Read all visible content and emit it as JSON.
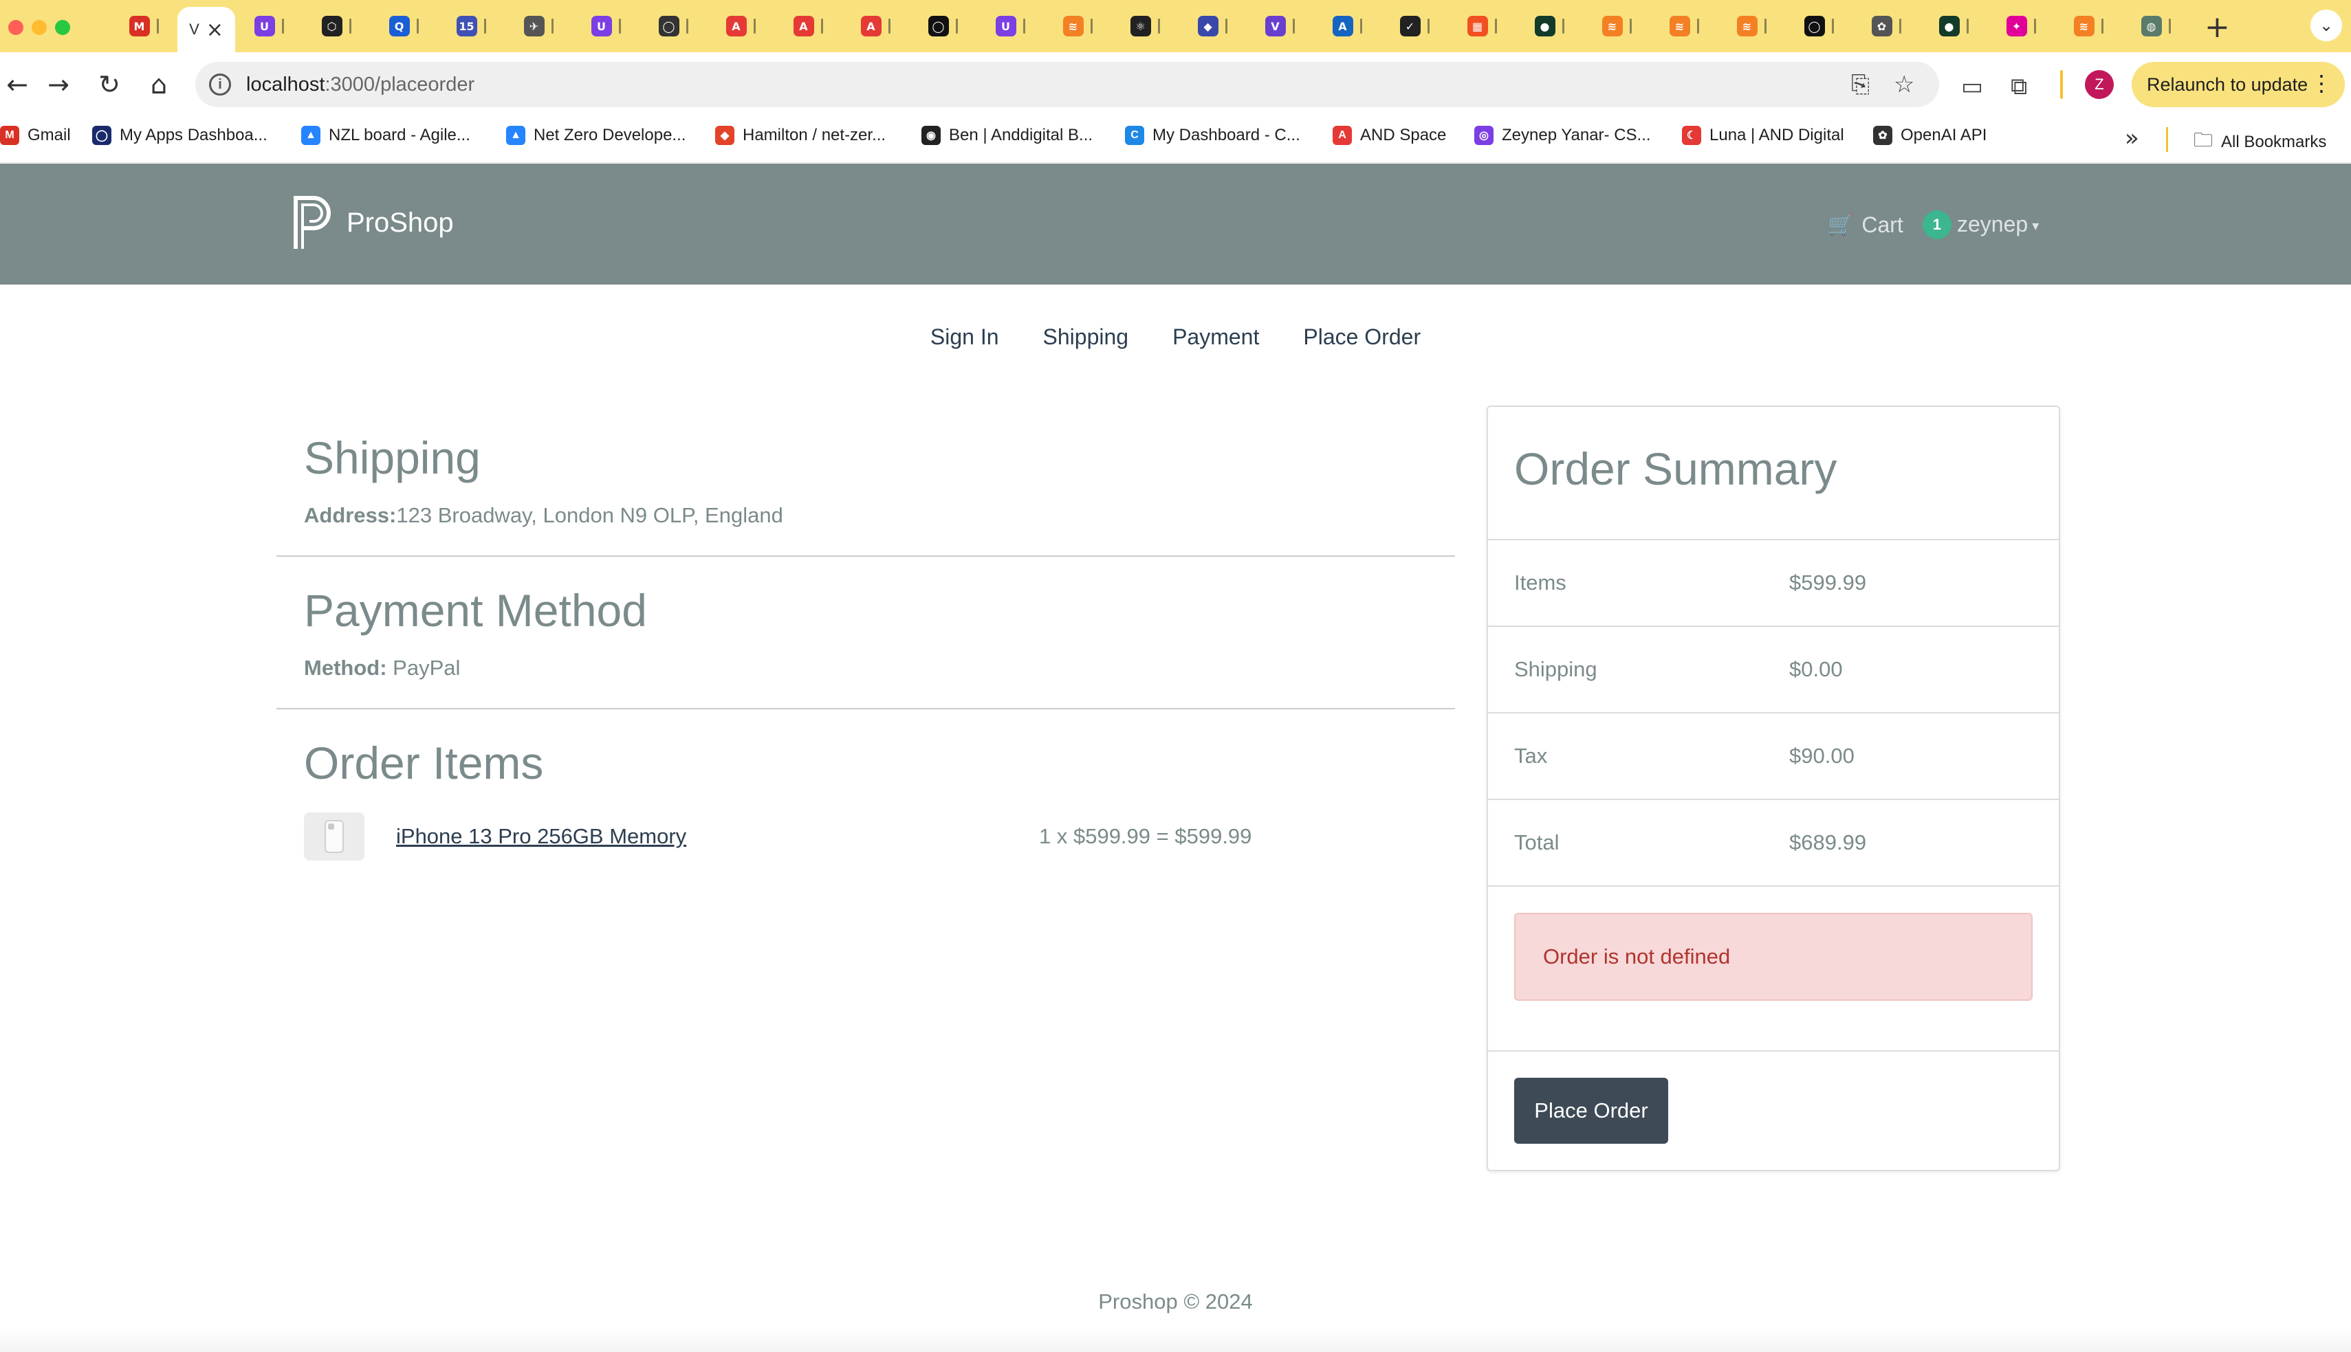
{
  "browser": {
    "active_tab_label": "V",
    "tabs": [
      {
        "icon": "gmail-icon",
        "label": "M",
        "color": "#d93025"
      },
      {
        "icon": "active-tab",
        "label": "V",
        "color": "#888888"
      },
      {
        "icon": "purple-u-icon",
        "label": "U",
        "color": "#7b3fe4"
      },
      {
        "icon": "hex-icon",
        "label": "⬡",
        "color": "#222222"
      },
      {
        "icon": "blue-q-icon",
        "label": "Q",
        "color": "#1a5fd6"
      },
      {
        "icon": "calendar-icon",
        "label": "15",
        "color": "#3f51b5"
      },
      {
        "icon": "send-icon",
        "label": "✈",
        "color": "#555555"
      },
      {
        "icon": "purple-u-icon",
        "label": "U",
        "color": "#7b3fe4"
      },
      {
        "icon": "github-icon",
        "label": "◯",
        "color": "#333333"
      },
      {
        "icon": "and-digital-icon",
        "label": "A",
        "color": "#e53935"
      },
      {
        "icon": "and-digital-icon",
        "label": "A",
        "color": "#e53935"
      },
      {
        "icon": "and-digital-icon",
        "label": "A",
        "color": "#e53935"
      },
      {
        "icon": "github-icon",
        "label": "◯",
        "color": "#111111"
      },
      {
        "icon": "purple-u-icon",
        "label": "U",
        "color": "#7b3fe4"
      },
      {
        "icon": "stack-icon",
        "label": "≋",
        "color": "#f48024"
      },
      {
        "icon": "react-icon",
        "label": "⚛",
        "color": "#222222"
      },
      {
        "icon": "cube-icon",
        "label": "◆",
        "color": "#3949ab"
      },
      {
        "icon": "shield-icon",
        "label": "V",
        "color": "#6a3fd0"
      },
      {
        "icon": "azure-icon",
        "label": "A",
        "color": "#1565c0"
      },
      {
        "icon": "nike-icon",
        "label": "✓",
        "color": "#222222"
      },
      {
        "icon": "microsoft-icon",
        "label": "▦",
        "color": "#f25022"
      },
      {
        "icon": "mongodb-icon",
        "label": "●",
        "color": "#133b2a"
      },
      {
        "icon": "stack-icon",
        "label": "≋",
        "color": "#f48024"
      },
      {
        "icon": "stack-icon",
        "label": "≋",
        "color": "#f48024"
      },
      {
        "icon": "stack-icon",
        "label": "≋",
        "color": "#f48024"
      },
      {
        "icon": "github-icon",
        "label": "◯",
        "color": "#111111"
      },
      {
        "icon": "openai-icon",
        "label": "✿",
        "color": "#555555"
      },
      {
        "icon": "mongodb-icon",
        "label": "●",
        "color": "#133b2a"
      },
      {
        "icon": "graphql-icon",
        "label": "✦",
        "color": "#e10098"
      },
      {
        "icon": "stack-icon",
        "label": "≋",
        "color": "#f48024"
      },
      {
        "icon": "bulb-icon",
        "label": "◍",
        "color": "#5a7a6a"
      }
    ],
    "url_host": "localhost",
    "url_path": ":3000/placeorder",
    "relaunch_label": "Relaunch to update",
    "profile_initial": "Z",
    "bookmarks": [
      {
        "label": "Gmail",
        "icon": "gmail-icon",
        "glyph": "M",
        "color": "#d93025"
      },
      {
        "label": "My Apps Dashboa...",
        "icon": "okta-icon",
        "glyph": "◯",
        "color": "#1b2a6b"
      },
      {
        "label": "NZL board - Agile...",
        "icon": "atlassian-icon",
        "glyph": "▲",
        "color": "#2684ff"
      },
      {
        "label": "Net Zero Develope...",
        "icon": "atlassian-icon",
        "glyph": "▲",
        "color": "#2684ff"
      },
      {
        "label": "Hamilton / net-zer...",
        "icon": "gitlab-icon",
        "glyph": "◆",
        "color": "#e24329"
      },
      {
        "label": "Ben | Anddigital B...",
        "icon": "eye-icon",
        "glyph": "◉",
        "color": "#222222"
      },
      {
        "label": "My Dashboard - C...",
        "icon": "c-icon",
        "glyph": "C",
        "color": "#1e88e5"
      },
      {
        "label": "AND Space",
        "icon": "and-digital-icon",
        "glyph": "A",
        "color": "#e53935"
      },
      {
        "label": "Zeynep Yanar- CS...",
        "icon": "purple-icon",
        "glyph": "◎",
        "color": "#7b3fe4"
      },
      {
        "label": "Luna | AND Digital",
        "icon": "luna-icon",
        "glyph": "☾",
        "color": "#e53935"
      },
      {
        "label": "OpenAI API",
        "icon": "openai-icon",
        "glyph": "✿",
        "color": "#333333"
      }
    ],
    "all_bookmarks_label": "All Bookmarks"
  },
  "header": {
    "brand": "ProShop",
    "cart_label": "Cart",
    "cart_count": "1",
    "username": "zeynep"
  },
  "steps": [
    "Sign In",
    "Shipping",
    "Payment",
    "Place Order"
  ],
  "shipping": {
    "title": "Shipping",
    "address_label": "Address:",
    "address": "123 Broadway, London N9 OLP, England"
  },
  "payment": {
    "title": "Payment Method",
    "method_label": "Method:",
    "method": "PayPal"
  },
  "order_items": {
    "title": "Order Items",
    "items": [
      {
        "name": "iPhone 13 Pro 256GB Memory",
        "price_line": "1 x $599.99 = $599.99"
      }
    ]
  },
  "summary": {
    "title": "Order Summary",
    "rows": [
      {
        "label": "Items",
        "value": "$599.99"
      },
      {
        "label": "Shipping",
        "value": "$0.00"
      },
      {
        "label": "Tax",
        "value": "$90.00"
      },
      {
        "label": "Total",
        "value": "$689.99"
      }
    ],
    "error": "Order is not defined",
    "button": "Place Order"
  },
  "footer": "Proshop © 2024",
  "colors": {
    "tabstrip": "#f9e27d",
    "header_bg": "#7b8a8b",
    "badge": "#3cb68e",
    "alert_bg": "#f6d9d8",
    "alert_text": "#b0342f",
    "button_bg": "#3e4a56"
  }
}
